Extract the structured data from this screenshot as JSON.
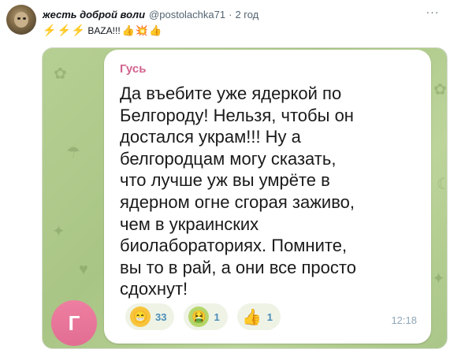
{
  "tweet": {
    "author_name": "жесть доброй воли",
    "handle": "@postolachka71",
    "separator": "·",
    "time": "2 год",
    "more_label": "···",
    "text": "BAZA!!!",
    "emoji_before": [
      "⚡",
      "⚡",
      "⚡"
    ],
    "emoji_after": [
      "👍",
      "💥",
      "👍"
    ]
  },
  "media": {
    "sender_name": "Гусь",
    "sender_initial": "Г",
    "message_text": "Да въебите уже ядеркой по Белгороду! Нельзя, чтобы он достался украм!!! Ну а белгородцам могу сказать, что лучше уж вы умрёте в ядерном огне сгорая заживо, чем в украинских биолабораториях. Помните, вы то в рай, а они все просто сдохнут!",
    "message_time": "12:18",
    "reactions": [
      {
        "emoji": "😁",
        "count": "33",
        "icon": "grinning-face-icon"
      },
      {
        "emoji": "🤮",
        "count": "1",
        "icon": "vomiting-face-icon"
      },
      {
        "emoji": "👍",
        "count": "1",
        "icon": "thumbs-up-icon"
      }
    ]
  },
  "colors": {
    "sender_name": "#d2638f",
    "background_pattern": "#b6cf93",
    "reaction_count": "#4a8db8"
  }
}
